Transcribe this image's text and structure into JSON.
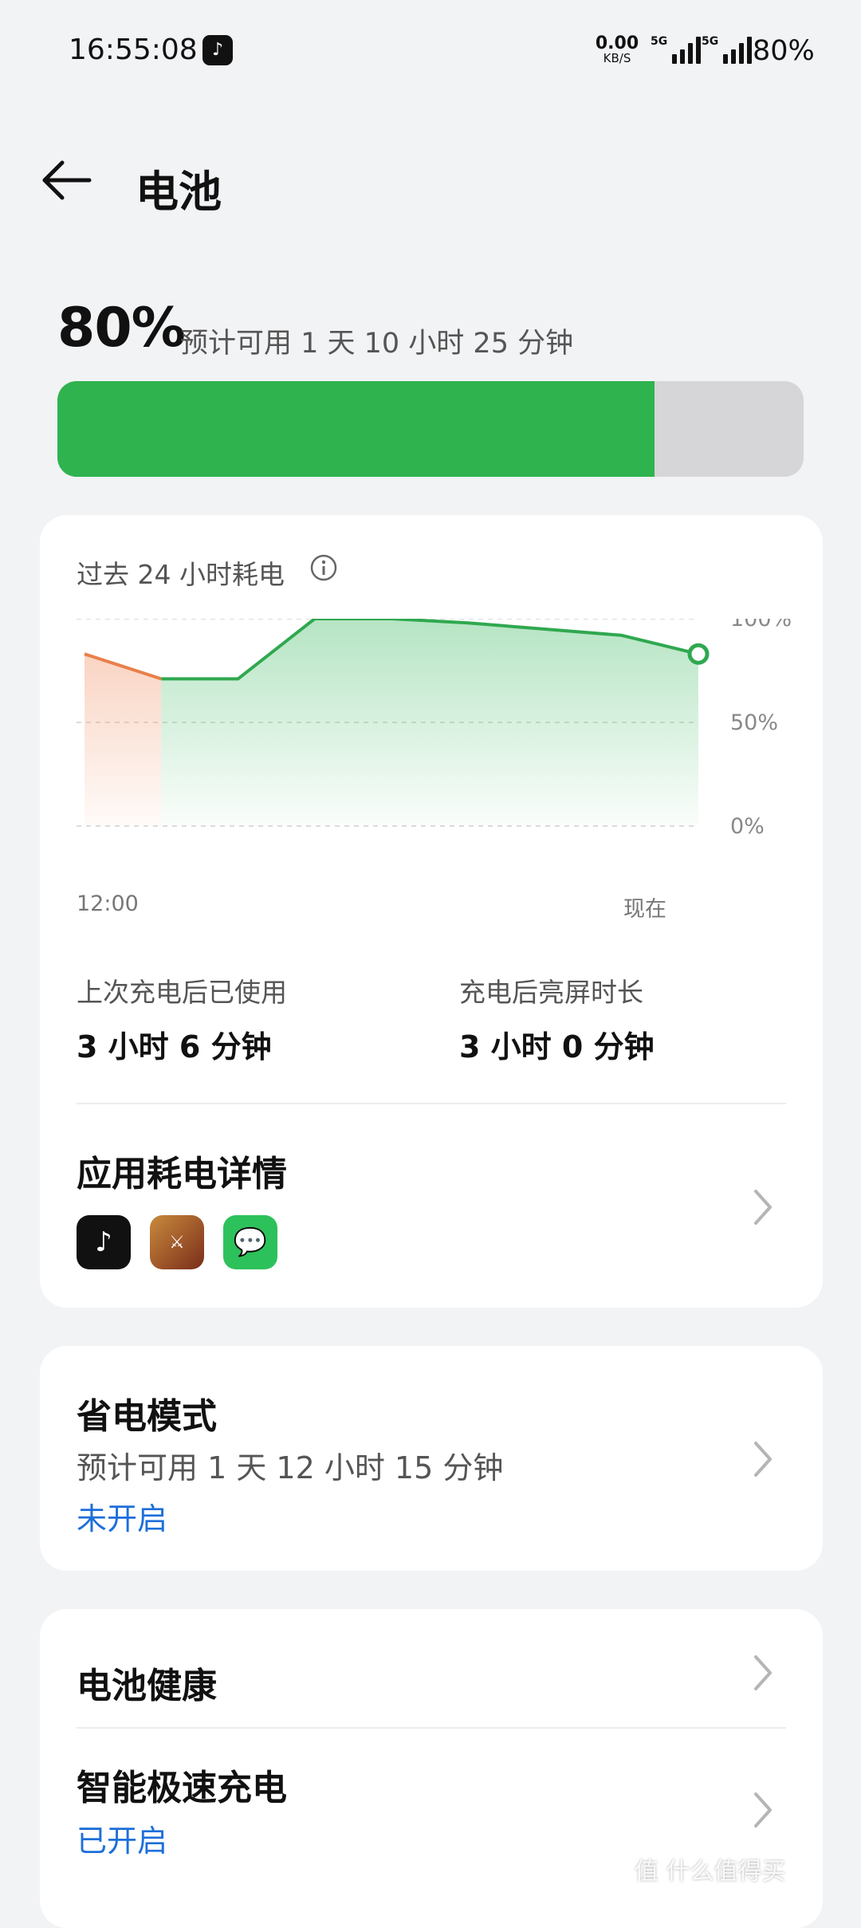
{
  "status_bar": {
    "time": "16:55:08",
    "app_notification_icon": "tiktok-icon",
    "net_speed_value": "0.00",
    "net_speed_unit": "KB/S",
    "network_1": "5G",
    "network_2": "5G",
    "battery": "80%"
  },
  "header": {
    "back_icon": "arrow-left-icon",
    "title": "电池"
  },
  "battery": {
    "percent_label": "80%",
    "level": 0.8,
    "estimate": "预计可用 1 天 10 小时 25 分钟",
    "fill_color": "#2fb34f",
    "track_color": "#d6d6d8"
  },
  "usage_card": {
    "chart_title": "过去 24 小时耗电",
    "info_icon": "info-icon",
    "x_start_label": "12:00",
    "x_end_label": "现在",
    "since_charge_label": "上次充电后已使用",
    "since_charge_value": "3 小时 6 分钟",
    "screen_on_label": "充电后亮屏时长",
    "screen_on_value": "3 小时 0 分钟",
    "app_usage_title": "应用耗电详情",
    "app_icons": [
      "tiktok-icon",
      "honor-of-kings-icon",
      "wechat-icon"
    ]
  },
  "chart_data": {
    "type": "area",
    "y_ticks": [
      "100%",
      "50%",
      "0%"
    ],
    "ylim": [
      0,
      100
    ],
    "grid": true,
    "x_labels": [
      "12:00",
      "现在"
    ],
    "series": [
      {
        "color": "#e8804a",
        "points": [
          [
            0,
            83
          ],
          [
            1,
            71
          ]
        ]
      },
      {
        "color": "#2fa84f",
        "points": [
          [
            1,
            71
          ],
          [
            2,
            71
          ],
          [
            3,
            100
          ],
          [
            4,
            100
          ],
          [
            5,
            98
          ],
          [
            6,
            95
          ],
          [
            7,
            92
          ],
          [
            8,
            83
          ]
        ]
      }
    ]
  },
  "power_saving": {
    "title": "省电模式",
    "estimate": "预计可用 1 天 12 小时 15 分钟",
    "state": "未开启"
  },
  "health": {
    "title": "电池健康"
  },
  "fast_charge": {
    "title": "智能极速充电",
    "state": "已开启"
  },
  "watermark": "值 什么值得买"
}
